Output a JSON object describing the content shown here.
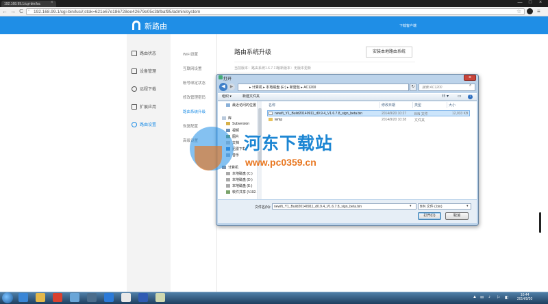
{
  "browser": {
    "tab_title": "192.168.99.1/cgi-bin/luc",
    "tab_close": "×",
    "url": "192.168.99.1/cgi-bin/luci/;stok=621e67e186728ee42679e05c3bfbaf95/admin/system",
    "nav_back": "←",
    "nav_forward": "→",
    "nav_reload": "C",
    "star": "☆",
    "menu": "≡",
    "win_min": "—",
    "win_max": "□",
    "win_close": "×"
  },
  "app": {
    "logo_text": "新路由",
    "header_link": "下载客户端",
    "accent": "#1f8ee6"
  },
  "left_nav": [
    {
      "label": "路由状态",
      "icon": "router-status-icon",
      "active": false
    },
    {
      "label": "设备管理",
      "icon": "devices-icon",
      "active": false
    },
    {
      "label": "远程下载",
      "icon": "download-icon",
      "active": false
    },
    {
      "label": "扩展应用",
      "icon": "apps-icon",
      "active": false
    },
    {
      "label": "路由设置",
      "icon": "settings-icon",
      "active": true
    }
  ],
  "sub_nav": [
    {
      "label": "WiFi设置",
      "active": false
    },
    {
      "label": "互联网设置",
      "active": false
    },
    {
      "label": "帐号绑定状态",
      "active": false
    },
    {
      "label": "修改管理密码",
      "active": false
    },
    {
      "label": "路由系统升级",
      "active": true
    },
    {
      "label": "恢复配置",
      "active": false
    },
    {
      "label": "高级设置",
      "active": false
    }
  ],
  "main": {
    "title": "路由系统升级",
    "install_button": "安装本地路由系统",
    "current_version": "当前版本：路由系统1.6.7.17",
    "latest_version": "最新版本：无版本更新"
  },
  "dialog": {
    "title": "打开",
    "close": "×",
    "back": "◀",
    "forward": "▶",
    "path": "▸ 计算机 ▸ 本地磁盘 (E:) ▸ 新建包 ▸ AC1200",
    "refresh": "↻",
    "search_placeholder": "搜索 AC1200",
    "search_icon": "⌕",
    "toolbar": {
      "organize": "组织 ▾",
      "new_folder": "新建文件夹",
      "view": "☷ ▾",
      "pane": "▭",
      "help": "?"
    },
    "tree": [
      {
        "label": "最近访问的位置",
        "indent": 1
      },
      {
        "label": "库",
        "indent": 0
      },
      {
        "label": "Subversion",
        "indent": 1
      },
      {
        "label": "视频",
        "indent": 1
      },
      {
        "label": "图片",
        "indent": 1
      },
      {
        "label": "文档",
        "indent": 1
      },
      {
        "label": "迅雷下载",
        "indent": 1
      },
      {
        "label": "音乐",
        "indent": 1
      },
      {
        "label": "计算机",
        "indent": 0
      },
      {
        "label": "本地磁盘 (C:)",
        "indent": 1
      },
      {
        "label": "本地磁盘 (D:)",
        "indent": 1
      },
      {
        "label": "本地磁盘 (E:)",
        "indent": 1
      },
      {
        "label": "软件共享 (\\\\192.",
        "indent": 1
      }
    ],
    "columns": [
      "名称",
      "修改日期",
      "类型",
      "大小"
    ],
    "files": [
      {
        "name": "newifi_Y1_Build20140911_d0.9.4_V1.6.7.8_sign_beta.bin",
        "date": "2014/9/20 10:27",
        "type": "BIN 文件",
        "size": "12,033 KB",
        "selected": true,
        "kind": "file"
      },
      {
        "name": "temp",
        "date": "2014/9/20 10:28",
        "type": "文件夹",
        "size": "",
        "selected": false,
        "kind": "folder"
      }
    ],
    "filename_label": "文件名(N):",
    "filename_value": "newifi_Y1_Build20140911_d0.9.4_V1.6.7.8_sign_beta.bin",
    "filetype_value": "BIN 文件 (.bin)",
    "dropdown_arrow": "▾",
    "open_button": "打开(O)",
    "cancel_button": "取消"
  },
  "watermark": {
    "name": "河东下载站",
    "url": "www.pc0359.cn"
  },
  "taskbar": {
    "time": "10:44",
    "date": "2014/9/20",
    "apps": [
      {
        "icon": "ie-icon",
        "color": "#3a86d6"
      },
      {
        "icon": "folder-icon",
        "color": "#e4b84a"
      },
      {
        "icon": "chrome-icon",
        "color": "#d9412f"
      },
      {
        "icon": "network-icon",
        "color": "#6aa6d8"
      },
      {
        "icon": "terminal-icon",
        "color": "#4b6d8c"
      },
      {
        "icon": "sogou-icon",
        "color": "#2b7ad8"
      },
      {
        "icon": "qq-icon",
        "color": "#e9e9e9"
      },
      {
        "icon": "word-icon",
        "color": "#2f5bb3"
      },
      {
        "icon": "explorer-icon",
        "color": "#cfd8b0"
      }
    ],
    "tray": [
      "▲",
      "✉",
      "♪",
      "⚐",
      "◧"
    ]
  }
}
